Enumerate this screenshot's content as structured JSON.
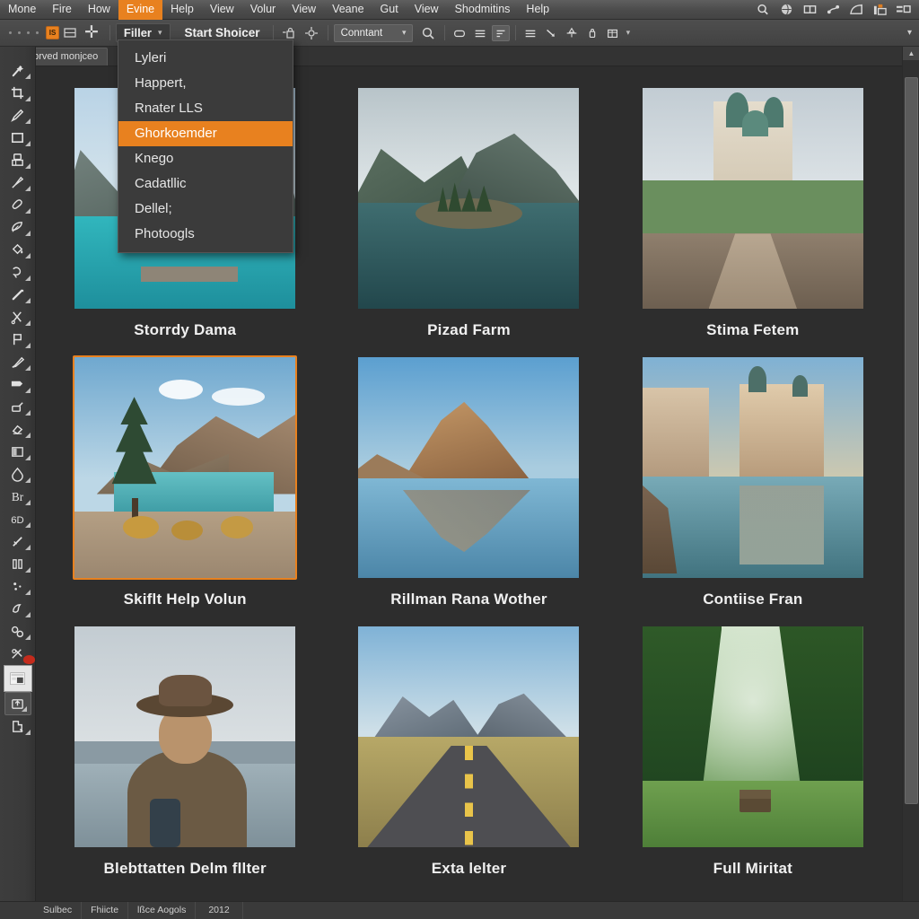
{
  "app": {
    "accent": "#e8811f",
    "bg": "#2d2d2d",
    "chrome": "#444444"
  },
  "menubar": {
    "items": [
      {
        "label": "Mone",
        "active": false
      },
      {
        "label": "Fire",
        "active": false
      },
      {
        "label": "How",
        "active": false
      },
      {
        "label": "Evine",
        "active": true
      },
      {
        "label": "Help",
        "active": false
      },
      {
        "label": "View",
        "active": false
      },
      {
        "label": "Volur",
        "active": false
      },
      {
        "label": "View",
        "active": false
      },
      {
        "label": "Veane",
        "active": false
      },
      {
        "label": "Gut",
        "active": false
      },
      {
        "label": "View",
        "active": false
      },
      {
        "label": "Shodmitins",
        "active": false
      },
      {
        "label": "Help",
        "active": false
      }
    ],
    "icons": [
      "search-icon",
      "globe-icon",
      "arrange-icon",
      "share-icon",
      "workspace-icon",
      "badge-icon",
      "layout-icon"
    ]
  },
  "optionsbar": {
    "swatch_label": "IS",
    "tool_dropdown": "Filler",
    "primary_button": "Start Shoicer",
    "mode_select": "Conntant",
    "select_caret": "▾",
    "icons": [
      "grid-icon",
      "move-icon",
      "lock-icon",
      "transform-icon",
      "search-icon",
      "shape-icon",
      "list-icon",
      "filter-icon",
      "align-icon",
      "line-icon",
      "curve-icon",
      "lock-small-icon",
      "table-icon"
    ]
  },
  "tabstrip": {
    "tab_label": "Dbrved monjceo"
  },
  "dropdown": {
    "items": [
      {
        "label": "Lyleri",
        "highlighted": false
      },
      {
        "label": "Happert,",
        "highlighted": false
      },
      {
        "label": "Rnater LLS",
        "highlighted": false
      },
      {
        "label": "Ghorkoemder",
        "highlighted": true
      },
      {
        "label": "Knego",
        "highlighted": false
      },
      {
        "label": "Cadatllic",
        "highlighted": false
      },
      {
        "label": "Dellel;",
        "highlighted": false
      },
      {
        "label": "Photoogls",
        "highlighted": false
      }
    ]
  },
  "toolpanel": {
    "tools": [
      {
        "name": "wand-icon",
        "style": "plain"
      },
      {
        "name": "crop-icon",
        "style": "plain"
      },
      {
        "name": "pencil-icon",
        "style": "plain"
      },
      {
        "name": "rectangle-icon",
        "style": "plain"
      },
      {
        "name": "stamp-icon",
        "style": "plain"
      },
      {
        "name": "brush-icon",
        "style": "plain"
      },
      {
        "name": "eraser-icon",
        "style": "plain"
      },
      {
        "name": "leaf-icon",
        "style": "plain"
      },
      {
        "name": "bucket-icon",
        "style": "plain"
      },
      {
        "name": "lasso-icon",
        "style": "plain"
      },
      {
        "name": "slice-icon",
        "style": "plain"
      },
      {
        "name": "scissors-icon",
        "style": "plain"
      },
      {
        "name": "flag-icon",
        "style": "plain"
      },
      {
        "name": "marker-icon",
        "style": "plain"
      },
      {
        "name": "banner-icon",
        "style": "plain"
      },
      {
        "name": "eyedropper-icon",
        "style": "plain"
      },
      {
        "name": "healing-icon",
        "style": "plain"
      },
      {
        "name": "gradient-icon",
        "style": "plain"
      },
      {
        "name": "blur-icon",
        "style": "plain"
      },
      {
        "name": "text-icon",
        "style": "plain"
      },
      {
        "name": "path-icon",
        "style": "plain"
      },
      {
        "name": "dodge-icon",
        "style": "plain"
      },
      {
        "name": "columns-icon",
        "style": "plain"
      },
      {
        "name": "sparkle-icon",
        "style": "plain"
      },
      {
        "name": "shape-tool-icon",
        "style": "plain"
      },
      {
        "name": "zoom-tool-icon",
        "style": "plain"
      },
      {
        "name": "notification-tool-icon",
        "style": "badge"
      },
      {
        "name": "layout-preview-icon",
        "style": "thumbsel"
      },
      {
        "name": "upload-icon",
        "style": "boxed"
      },
      {
        "name": "export-icon",
        "style": "plain"
      }
    ]
  },
  "gallery": {
    "items": [
      {
        "caption": "Storrdy Dama",
        "image": "lake-castle-tower",
        "selected": false
      },
      {
        "caption": "Pizad Farm",
        "image": "island-lake-mountains",
        "selected": false
      },
      {
        "caption": "Stima Fetem",
        "image": "cathedral-boardwalk",
        "selected": false
      },
      {
        "caption": "Skiflt Help Volun",
        "image": "pine-tree-mountain-lake",
        "selected": true
      },
      {
        "caption": "Rillman Rana Wother",
        "image": "rock-reflection-lake",
        "selected": false
      },
      {
        "caption": "Contiise Fran",
        "image": "palace-waterfront",
        "selected": false
      },
      {
        "caption": "Blebttatten Delm fllter",
        "image": "man-hat-backpack-lake",
        "selected": false
      },
      {
        "caption": "Exta lelter",
        "image": "road-mountains-field",
        "selected": false
      },
      {
        "caption": "Full Miritat",
        "image": "forest-green-bench",
        "selected": false
      }
    ]
  },
  "scrollbar": {
    "up_arrow": "▲",
    "down_arrow": "▼",
    "thumb_top_pct": 2,
    "thumb_height_pct": 86
  },
  "statusbar": {
    "cells": [
      "Sulbec",
      "Fhiicte",
      "lßce Aogols",
      "2012"
    ]
  }
}
